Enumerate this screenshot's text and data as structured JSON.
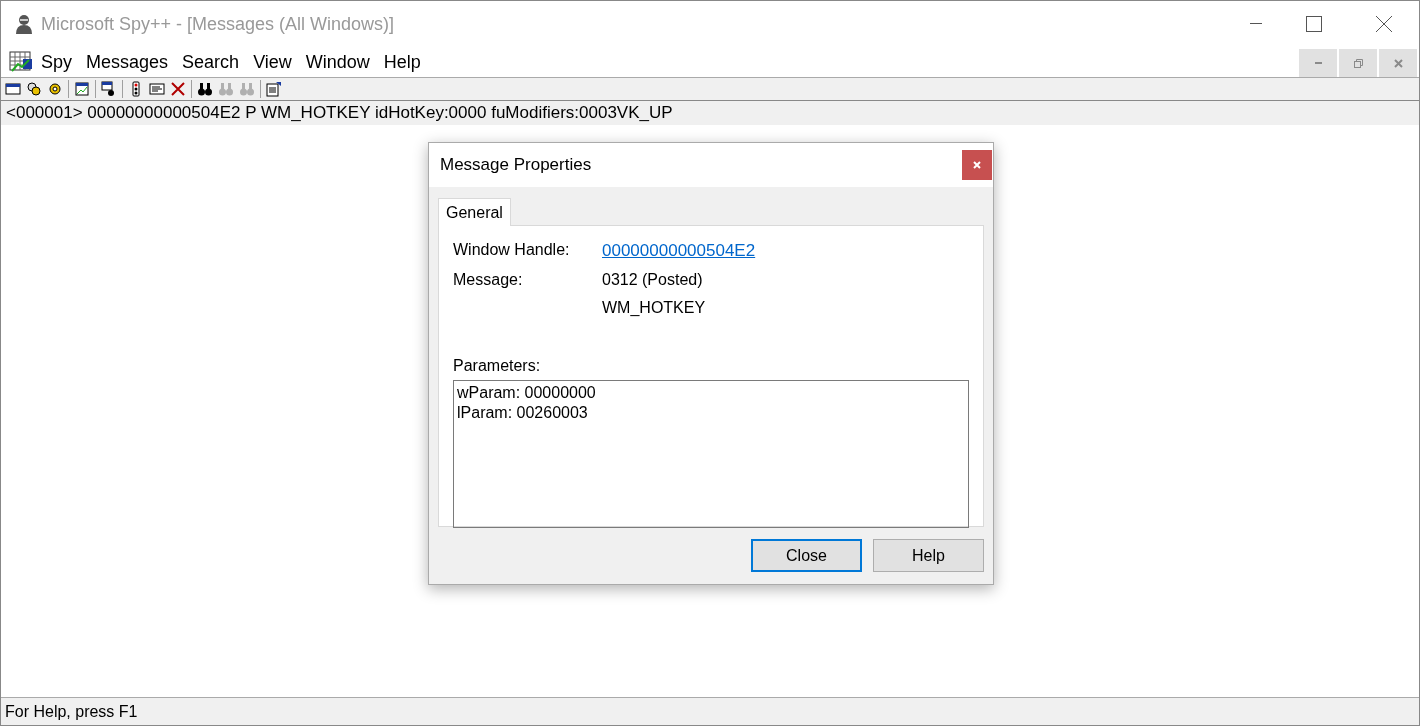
{
  "window": {
    "title": "Microsoft Spy++ - [Messages (All Windows)]",
    "active": false
  },
  "menu": [
    "Spy",
    "Messages",
    "Search",
    "View",
    "Window",
    "Help"
  ],
  "toolbar": [
    {
      "kind": "window",
      "disabled": false
    },
    {
      "kind": "gears",
      "disabled": false
    },
    {
      "kind": "gear",
      "disabled": false
    },
    {
      "kind": "sep"
    },
    {
      "kind": "graph",
      "disabled": false
    },
    {
      "kind": "sep"
    },
    {
      "kind": "find",
      "disabled": false
    },
    {
      "kind": "sep"
    },
    {
      "kind": "light",
      "disabled": false
    },
    {
      "kind": "props",
      "disabled": false
    },
    {
      "kind": "clear",
      "disabled": false
    },
    {
      "kind": "sep"
    },
    {
      "kind": "binoculars",
      "disabled": false
    },
    {
      "kind": "binoculars",
      "disabled": true
    },
    {
      "kind": "binoculars",
      "disabled": true
    },
    {
      "kind": "sep"
    },
    {
      "kind": "options",
      "disabled": false
    }
  ],
  "messages": [
    {
      "text": "<000001> 00000000000504E2 P WM_HOTKEY idHotKey:0000 fuModifiers:0003VK_UP",
      "selected": false
    }
  ],
  "dialog": {
    "title": "Message Properties",
    "tabs": [
      {
        "label": "General",
        "selected": true
      }
    ],
    "fields": [
      {
        "label": "Window Handle:",
        "values": [
          "00000000000504E2"
        ],
        "kind": "link"
      },
      {
        "label": "Message:",
        "values": [
          "0312  (Posted)",
          "WM_HOTKEY"
        ],
        "kind": "text"
      }
    ],
    "parameters_label": "Parameters:",
    "parameters": [
      "wParam: 00000000",
      "lParam: 00260003"
    ],
    "buttons": [
      {
        "label": "Close",
        "default": true
      },
      {
        "label": "Help",
        "default": false
      }
    ]
  },
  "status_bar": "For Help, press F1"
}
